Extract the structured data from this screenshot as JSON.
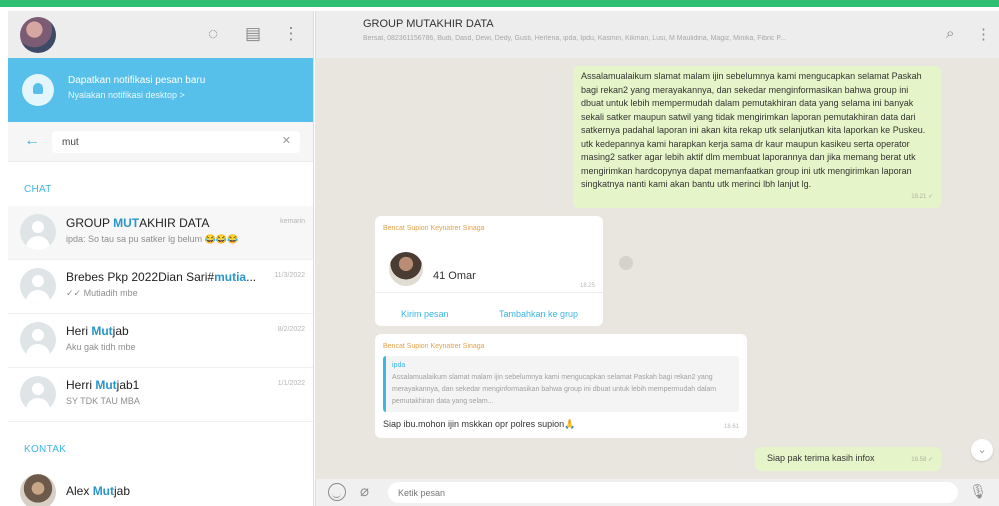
{
  "sidebar": {
    "notification": {
      "title": "Dapatkan notifikasi pesan baru",
      "subtitle": "Nyalakan notifikasi desktop >"
    },
    "search": {
      "value": "mut"
    },
    "chats_label": "CHAT",
    "contacts_label": "KONTAK",
    "chats": [
      {
        "name_before": "GROUP ",
        "name_match": "MUT",
        "name_after": "AKHIR DATA",
        "time": "kemarin",
        "preview": "ipda: So tau sa pu satker lg belum 😂😂😂"
      },
      {
        "name_before": "Brebes Pkp 2022Dian Sari#",
        "name_match": "mutia",
        "name_after": "...",
        "time": "11/3/2022",
        "preview": "✓✓ Mutiadih mbe"
      },
      {
        "name_before": "Heri ",
        "name_match": "Mut",
        "name_after": "jab",
        "time": "8/2/2022",
        "preview": "Aku gak tidh mbe"
      },
      {
        "name_before": "Herri ",
        "name_match": "Mut",
        "name_after": "jab1",
        "time": "1/1/2022",
        "preview": "SY TDK TAU MBA"
      }
    ],
    "contacts": [
      {
        "name_before": "Alex ",
        "name_match": "Mut",
        "name_after": "jab"
      }
    ]
  },
  "chat": {
    "title": "GROUP MUTAKHIR DATA",
    "members": "Bersat, 082361156786, Budi, Dasd, Dewi, Dedy, Gusti, Herlena, ipda, Ipdu, Kasmin, Kikman, Lusi, M Maulidina, Magiz, Minika, Fibric P...",
    "messages": [
      {
        "type": "outgoing",
        "text": "Assalamualaikum slamat malam ijin sebelumnya kami mengucapkan selamat Paskah bagi rekan2 yang merayakannya, dan sekedar menginformasikan bahwa group ini dbuat untuk lebih mempermudah dalam pemutakhiran data yang selama ini banyak sekali satker maupun satwil yang tidak mengirimkan laporan pemutakhiran data dari satkernya padahal laporan ini akan kita rekap utk selanjutkan kita laporkan ke Puskeu. utk kedepannya kami harapkan kerja sama dr kaur maupun kasikeu serta operator masing2 satker agar lebih aktif dlm membuat laporannya dan jika memang berat utk mengirimkan hardcopynya dapat memanfaatkan group ini utk mengirimkan laporan singkatnya nanti kami akan bantu utk merinci lbh lanjut lg.",
        "time": "18.21 ✓"
      },
      {
        "type": "contact-card",
        "sender": "Bencat Supion Keynatrer Sinaga",
        "contact_name": "41 Omar",
        "time": "18.25",
        "action_left": "Kirim pesan",
        "action_right": "Tambahkan ke grup"
      },
      {
        "type": "reply",
        "sender": "Bencat Supion Keynatrer Sinaga",
        "quote_name": "ipda",
        "quote_text": "Assalamualaikum slamat malam ijin sebelumnya kami mengucapkan selamat Paskah bagi rekan2 yang merayakannya, dan sekedar menginformasikan bahwa group ini dbuat untuk lebih mempermudah dalam pemutakhiran data yang selam...",
        "text": "Siap ibu.mohon ijin mskkan opr polres supion🙏",
        "time": "18.61"
      },
      {
        "type": "outgoing",
        "text": "Siap pak terima kasih infox",
        "time": "18.58 ✓"
      }
    ],
    "composer_placeholder": "Ketik pesan"
  }
}
